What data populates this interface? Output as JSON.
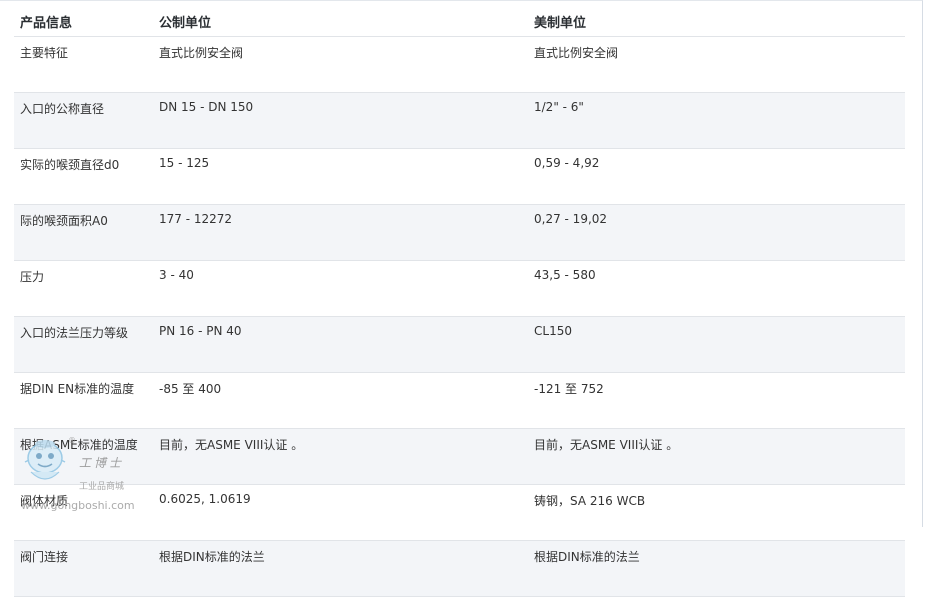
{
  "table": {
    "headers": [
      "产品信息",
      "公制单位",
      "美制单位"
    ],
    "rows": [
      {
        "label": "主要特征",
        "metric": "直式比例安全阀",
        "imperial": "直式比例安全阀"
      },
      {
        "label": "入口的公称直径",
        "metric": "DN 15  -  DN 150",
        "imperial": "1/2\"  -  6\""
      },
      {
        "label": "实际的喉颈直径d0",
        "metric": "15  -  125",
        "imperial": "0,59  -  4,92"
      },
      {
        "label": "际的喉颈面积A0",
        "metric": "177  -  12272",
        "imperial": "0,27  -  19,02"
      },
      {
        "label": "压力",
        "metric": "3  -  40",
        "imperial": "43,5  -  580"
      },
      {
        "label": "入口的法兰压力等级",
        "metric": "PN 16  -  PN 40",
        "imperial": "CL150"
      },
      {
        "label": "据DIN EN标准的温度",
        "metric": "-85  至  400",
        "imperial": "-121  至  752"
      },
      {
        "label": "根据ASME标准的温度",
        "metric": "目前，无ASME VIII认证 。",
        "imperial": "目前，无ASME VIII认证 。"
      },
      {
        "label": "阀体材质",
        "metric": "0.6025, 1.0619",
        "imperial": "铸钢，SA 216 WCB"
      },
      {
        "label": "阀门连接",
        "metric": "根据DIN标准的法兰",
        "imperial": "根据DIN标准的法兰"
      }
    ]
  },
  "watermark": {
    "brand": "工博士",
    "subtitle": "工业品商城",
    "url": "www.gongboshi.com",
    "registered": "®"
  },
  "colors": {
    "row_alt_bg": "#f3f5f8",
    "border": "#e1e4e8",
    "text": "#333333"
  }
}
